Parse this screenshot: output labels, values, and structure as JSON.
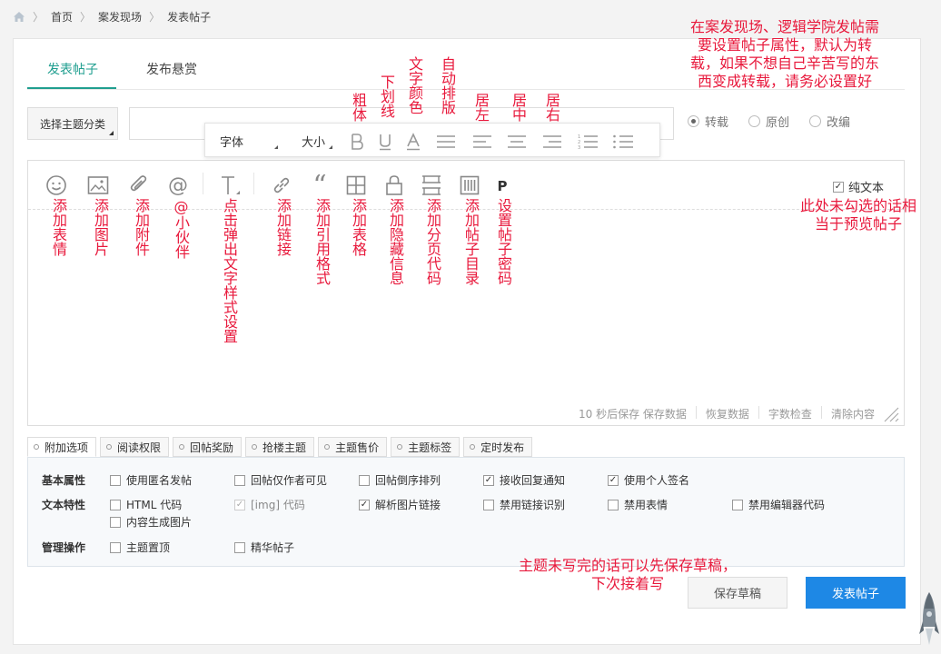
{
  "breadcrumb": {
    "home": "首页",
    "section": "案发现场",
    "current": "发表帖子"
  },
  "tabs": {
    "post": "发表帖子",
    "reward": "发布悬赏"
  },
  "category_select": "选择主题分类",
  "attribute_options": [
    "转载",
    "原创",
    "改编"
  ],
  "attribute_selected": "转载",
  "text_style_popup": {
    "font": "字体",
    "size": "大小"
  },
  "plain_text_label": "纯文本",
  "plain_text_checked": true,
  "status_bar": {
    "autosave": "10 秒后保存 保存数据",
    "restore": "恢复数据",
    "count": "字数检查",
    "clear": "清除内容"
  },
  "option_tabs": [
    "附加选项",
    "阅读权限",
    "回帖奖励",
    "抢楼主题",
    "主题售价",
    "主题标签",
    "定时发布"
  ],
  "options": {
    "basic_label": "基本属性",
    "basic": [
      {
        "label": "使用匿名发帖",
        "checked": false
      },
      {
        "label": "回帖仅作者可见",
        "checked": false
      },
      {
        "label": "回帖倒序排列",
        "checked": false
      },
      {
        "label": "接收回复通知",
        "checked": true
      },
      {
        "label": "使用个人签名",
        "checked": true
      }
    ],
    "text_label": "文本特性",
    "text": [
      {
        "label": "HTML 代码",
        "checked": false
      },
      {
        "label": "[img] 代码",
        "checked": true,
        "disabled": true
      },
      {
        "label": "解析图片链接",
        "checked": true
      },
      {
        "label": "禁用链接识别",
        "checked": false
      },
      {
        "label": "禁用表情",
        "checked": false
      },
      {
        "label": "禁用编辑器代码",
        "checked": false
      },
      {
        "label": "内容生成图片",
        "checked": false
      }
    ],
    "manage_label": "管理操作",
    "manage": [
      {
        "label": "主题置顶",
        "checked": false
      },
      {
        "label": "精华帖子",
        "checked": false
      }
    ]
  },
  "buttons": {
    "draft": "保存草稿",
    "publish": "发表帖子"
  },
  "annotations": {
    "top_right": "在案发现场、逻辑学院发帖需要设置帖子属性，默认为转载，如果不想自己辛苦写的东西变成转载，请务必设置好",
    "plain_text_note": "此处未勾选的话相当于预览帖子",
    "draft_note": "主题未写完的话可以先保存草稿，下次接着写",
    "style_labels": [
      "粗体",
      "下划线",
      "文字颜色",
      "自动排版",
      "居左",
      "居中",
      "居右"
    ],
    "toolbar_labels": [
      "添加表情",
      "添加图片",
      "添加附件",
      "@小伙伴",
      "点击弹出文字样式设置",
      "添加链接",
      "添加引用格式",
      "添加表格",
      "添加隐藏信息",
      "添加分页代码",
      "添加帖子目录",
      "设置帖子密码"
    ]
  },
  "colors": {
    "accent": "#1f9e8f",
    "annotation": "#e8193c",
    "publish": "#1e88e5"
  }
}
